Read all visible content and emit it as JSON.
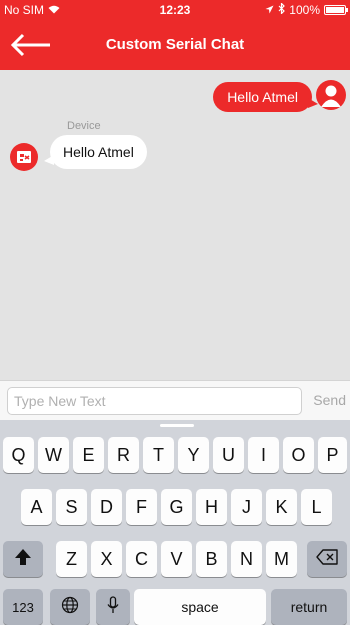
{
  "status": {
    "carrier": "No SIM",
    "time": "12:23",
    "battery": "100%"
  },
  "nav": {
    "title": "Custom Serial Chat"
  },
  "chat": {
    "outgoing": {
      "text": "Hello Atmel"
    },
    "incoming": {
      "sender": "Device",
      "text": "Hello Atmel"
    }
  },
  "composer": {
    "placeholder": "Type New Text",
    "send_label": "Send"
  },
  "keyboard": {
    "row1": [
      "Q",
      "W",
      "E",
      "R",
      "T",
      "Y",
      "U",
      "I",
      "O",
      "P"
    ],
    "row2": [
      "A",
      "S",
      "D",
      "F",
      "G",
      "H",
      "J",
      "K",
      "L"
    ],
    "row3": [
      "Z",
      "X",
      "C",
      "V",
      "B",
      "N",
      "M"
    ],
    "numbers_label": "123",
    "space_label": "space",
    "return_label": "return"
  },
  "colors": {
    "accent": "#ec2a2a",
    "chat_bg": "#e3e3e3",
    "keyboard_bg": "#d1d4da"
  }
}
